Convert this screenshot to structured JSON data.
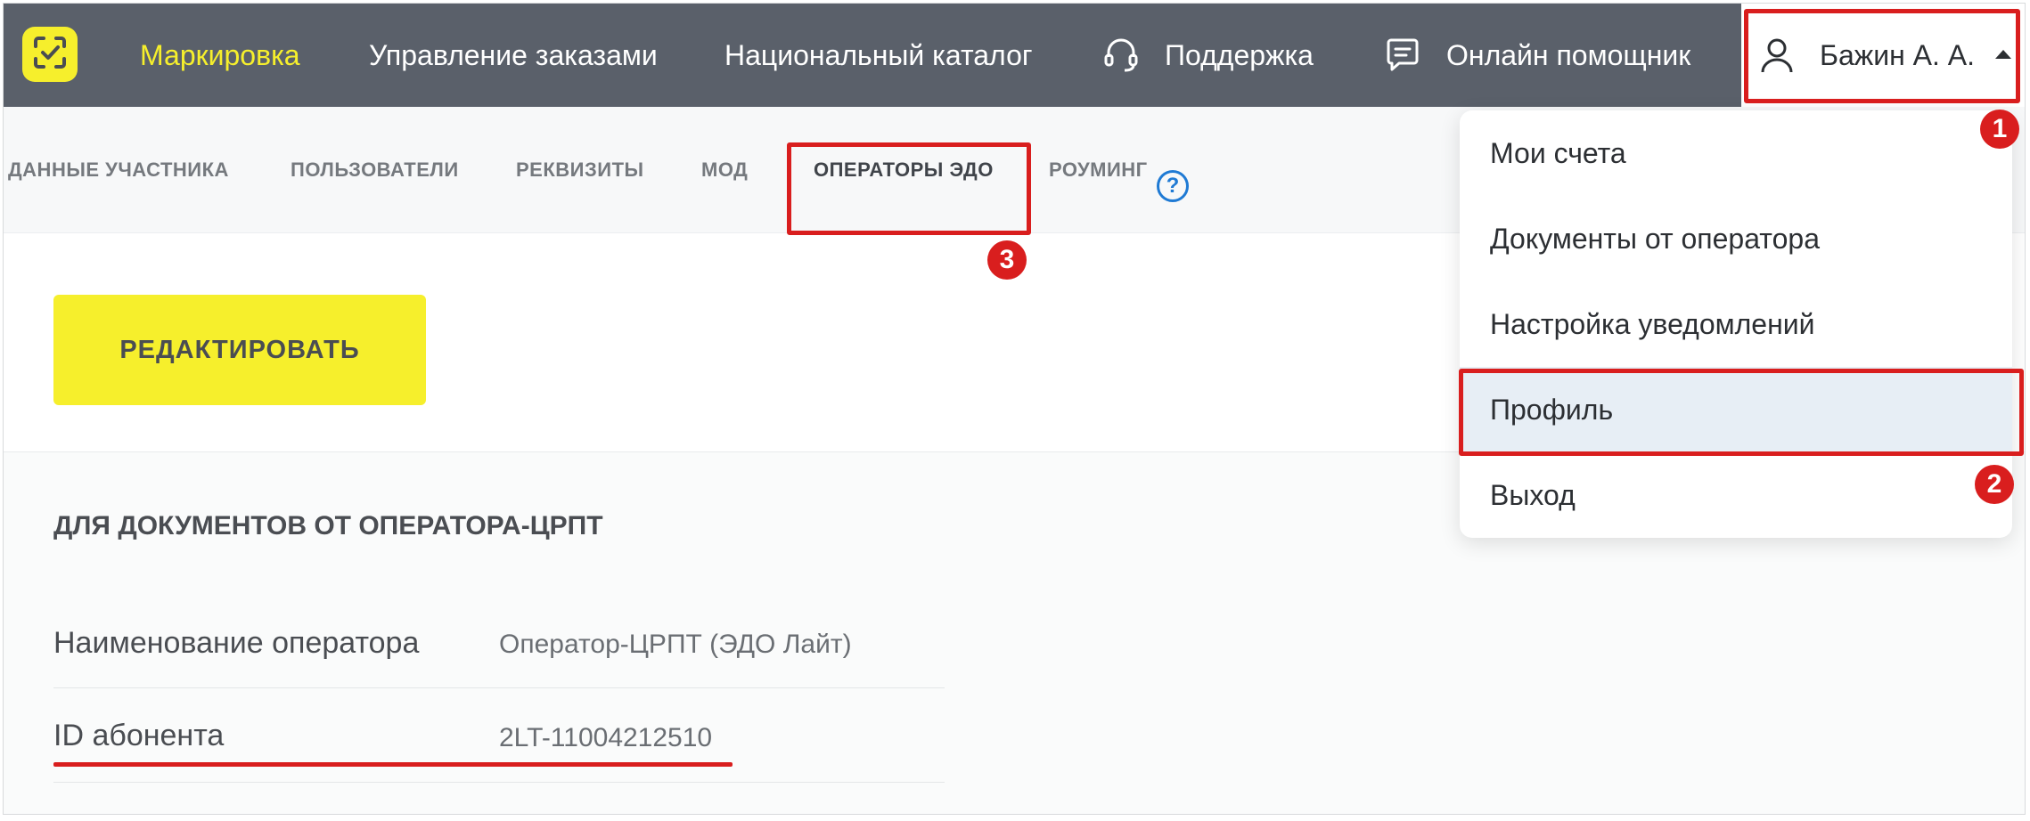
{
  "header": {
    "logo_icon": "check-frame-icon",
    "nav": [
      {
        "label": "Маркировка",
        "active": true
      },
      {
        "label": "Управление заказами"
      },
      {
        "label": "Национальный каталог"
      },
      {
        "label": "Поддержка",
        "icon": "headset-icon"
      },
      {
        "label": "Онлайн помощник",
        "icon": "chat-icon"
      }
    ],
    "user": {
      "name": "Бажин А. А.",
      "icon": "user-icon"
    }
  },
  "tabs": [
    {
      "label": "ДАННЫЕ УЧАСТНИКА"
    },
    {
      "label": "ПОЛЬЗОВАТЕЛИ"
    },
    {
      "label": "РЕКВИЗИТЫ"
    },
    {
      "label": "МОД"
    },
    {
      "label": "ОПЕРАТОРЫ ЭДО",
      "active": true
    },
    {
      "label": "РОУМИНГ",
      "help_icon": "?"
    }
  ],
  "actions": {
    "edit_label": "РЕДАКТИРОВАТЬ"
  },
  "section": {
    "title": "ДЛЯ ДОКУМЕНТОВ ОТ ОПЕРАТОРА-ЦРПТ",
    "fields": [
      {
        "label": "Наименование оператора",
        "value": "Оператор-ЦРПТ (ЭДО Лайт)"
      },
      {
        "label": "ID абонента",
        "value": "2LT-11004212510"
      }
    ]
  },
  "user_menu": {
    "items": [
      {
        "label": "Мои счета"
      },
      {
        "label": "Документы от оператора"
      },
      {
        "label": "Настройка уведомлений"
      },
      {
        "label": "Профиль",
        "selected": true
      },
      {
        "label": "Выход"
      }
    ]
  },
  "annotations": {
    "badges": [
      "1",
      "2",
      "3"
    ],
    "color": "#d91e1e"
  },
  "colors": {
    "header_bg": "#5a606a",
    "accent_yellow": "#f6ef2c",
    "help_blue": "#1f7ad4",
    "menu_selected_bg": "#e7eef5"
  }
}
